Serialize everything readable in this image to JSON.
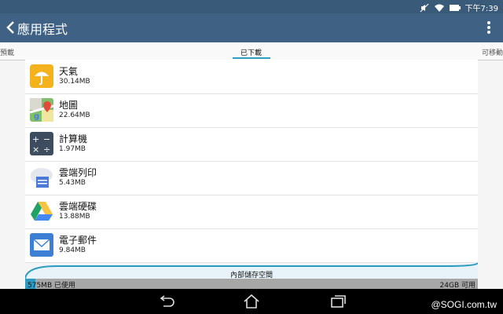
{
  "status_bar": {
    "time": "下午7:39",
    "icons": [
      "mute-icon",
      "wifi-icon",
      "battery-icon"
    ]
  },
  "app_bar": {
    "title": "應用程式",
    "back_icon": "chevron-left-icon",
    "menu_icon": "overflow-menu-icon"
  },
  "tabs": [
    {
      "label": "預載",
      "selected": false
    },
    {
      "label": "已下載",
      "selected": true
    },
    {
      "label": "可移動",
      "selected": false
    }
  ],
  "apps": [
    {
      "name": "天氣",
      "size": "30.14MB",
      "icon": "weather-umbrella-icon"
    },
    {
      "name": "地圖",
      "size": "22.64MB",
      "icon": "maps-icon"
    },
    {
      "name": "計算機",
      "size": "1.97MB",
      "icon": "calculator-icon"
    },
    {
      "name": "雲端列印",
      "size": "5.43MB",
      "icon": "cloud-print-icon"
    },
    {
      "name": "雲端硬碟",
      "size": "13.88MB",
      "icon": "drive-icon"
    },
    {
      "name": "電子郵件",
      "size": "9.84MB",
      "icon": "email-icon"
    }
  ],
  "storage": {
    "label": "內部儲存空間",
    "used_text": "575MB 已使用",
    "available_text": "24GB 可用",
    "used_fraction": 0.023
  },
  "nav_bar": {
    "buttons": [
      "back-icon",
      "home-icon",
      "recents-icon"
    ]
  },
  "watermark": "@SOGI.com.tw",
  "colors": {
    "app_bar": "#3f6184",
    "accent": "#2c9bbf",
    "storage_free": "#a7a7a7"
  }
}
